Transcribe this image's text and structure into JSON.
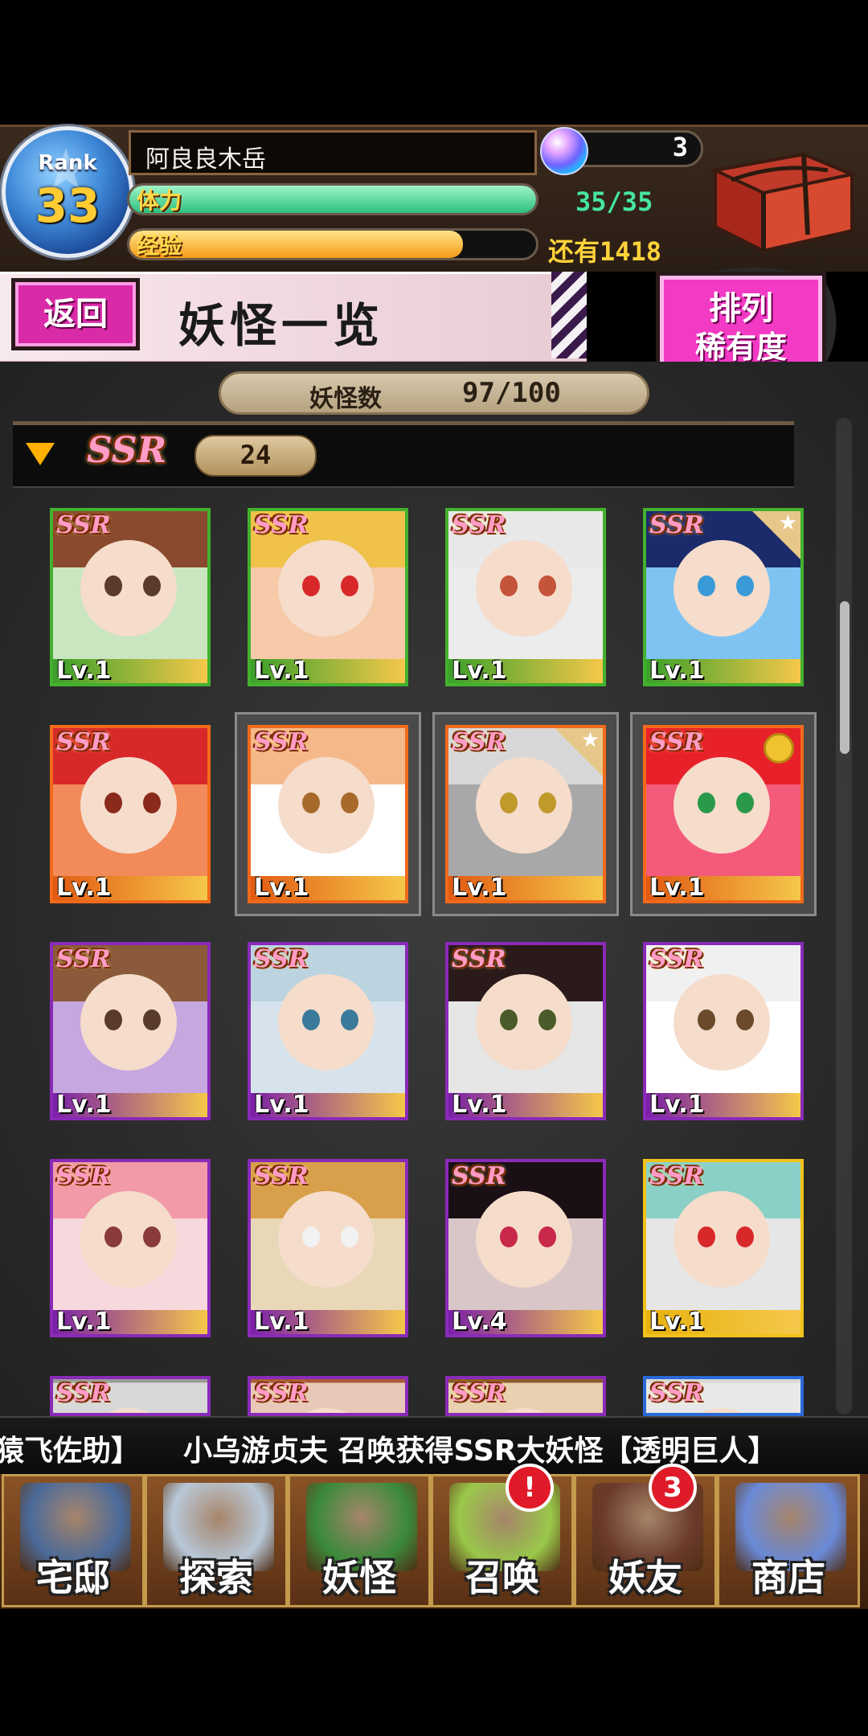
{
  "header": {
    "rank_label": "Rank",
    "rank_value": "33",
    "player_name": "阿良良木岳",
    "gem_count": "3",
    "stamina_label": "体力",
    "stamina_value": "35/35",
    "stamina_fraction": 1.0,
    "exp_label": "经验",
    "exp_remaining": "还有1418",
    "exp_fraction": 0.82
  },
  "titlebar": {
    "back_label": "返回",
    "page_title": "妖怪一览",
    "sort_title": "排列",
    "sort_mode": "稀有度"
  },
  "summary": {
    "count_label": "妖怪数",
    "count_value": "97/100"
  },
  "section": {
    "rarity": "SSR",
    "count": "24"
  },
  "cards": [
    {
      "rarity": "SSR",
      "level": "Lv.1",
      "frame": "#43b12e",
      "level_bar": "#3aa02a",
      "hair": "#8a4a2e",
      "eye": "#5a3a2a",
      "bg": "#c9e6c1"
    },
    {
      "rarity": "SSR",
      "level": "Lv.1",
      "frame": "#43b12e",
      "level_bar": "#3aa02a",
      "hair": "#f0c24a",
      "eye": "#d8282a",
      "bg": "#f6c9a8"
    },
    {
      "rarity": "SSR",
      "level": "Lv.1",
      "frame": "#43b12e",
      "level_bar": "#3aa02a",
      "hair": "#e8e8e8",
      "eye": "#c4543a",
      "bg": "#ececec"
    },
    {
      "rarity": "SSR",
      "level": "Lv.1",
      "frame": "#43b12e",
      "level_bar": "#3aa02a",
      "hair": "#1a2a6a",
      "eye": "#3a9ad8",
      "bg": "#7ec3f2",
      "star": true
    },
    {
      "rarity": "SSR",
      "level": "Lv.1",
      "frame": "#f26a1b",
      "level_bar": "#e25a12",
      "hair": "#d8282a",
      "eye": "#8a2a1a",
      "bg": "#f28a5a"
    },
    {
      "rarity": "SSR",
      "level": "Lv.1",
      "frame": "#f26a1b",
      "level_bar": "#e25a12",
      "hair": "#f5b88a",
      "eye": "#a86a2a",
      "bg": "#ffffff",
      "selected": true
    },
    {
      "rarity": "SSR",
      "level": "Lv.1",
      "frame": "#f26a1b",
      "level_bar": "#e25a12",
      "hair": "#d8d8d8",
      "eye": "#c09a2a",
      "bg": "#a8a8a8",
      "star": true,
      "selected": true
    },
    {
      "rarity": "SSR",
      "level": "Lv.1",
      "frame": "#f26a1b",
      "level_bar": "#e25a12",
      "hair": "#e8202a",
      "eye": "#2a9a4a",
      "bg": "#f45a7a",
      "crown": true,
      "selected": true
    },
    {
      "rarity": "SSR",
      "level": "Lv.1",
      "frame": "#8a2ab8",
      "level_bar": "#7a1fa8",
      "hair": "#8a5a3a",
      "eye": "#5a3a2a",
      "bg": "#c6a7e0"
    },
    {
      "rarity": "SSR",
      "level": "Lv.1",
      "frame": "#8a2ab8",
      "level_bar": "#7a1fa8",
      "hair": "#bcd3e0",
      "eye": "#3a7a9a",
      "bg": "#d6e3ec"
    },
    {
      "rarity": "SSR",
      "level": "Lv.1",
      "frame": "#8a2ab8",
      "level_bar": "#7a1fa8",
      "hair": "#2a1a1a",
      "eye": "#4a5a2a",
      "bg": "#e6e6e6"
    },
    {
      "rarity": "SSR",
      "level": "Lv.1",
      "frame": "#8a2ab8",
      "level_bar": "#7a1fa8",
      "hair": "#f0f0f0",
      "eye": "#6a4a2a",
      "bg": "#ffffff"
    },
    {
      "rarity": "SSR",
      "level": "Lv.1",
      "frame": "#8a2ab8",
      "level_bar": "#7a1fa8",
      "hair": "#f29aa8",
      "eye": "#8a3a3a",
      "bg": "#f7d8dc"
    },
    {
      "rarity": "SSR",
      "level": "Lv.1",
      "frame": "#8a2ab8",
      "level_bar": "#7a1fa8",
      "hair": "#d8a04a",
      "eye": "#f2f2f2",
      "bg": "#e8d8b8"
    },
    {
      "rarity": "SSR",
      "level": "Lv.4",
      "frame": "#8a2ab8",
      "level_bar": "#7a1fa8",
      "hair": "#1a0f14",
      "eye": "#c8284a",
      "bg": "#d8c6c8"
    },
    {
      "rarity": "SSR",
      "level": "Lv.1",
      "frame": "#f2c21a",
      "level_bar": "#e8b210",
      "hair": "#8ad0c6",
      "eye": "#d8282a",
      "bg": "#e6e6e6"
    },
    {
      "rarity": "SSR",
      "level": "",
      "frame": "#8a2ab8",
      "level_bar": "#7a1fa8",
      "hair": "#9a9a9a",
      "eye": "#333333",
      "bg": "#d8d8d8"
    },
    {
      "rarity": "SSR",
      "level": "",
      "frame": "#8a2ab8",
      "level_bar": "#7a1fa8",
      "hair": "#a85a3a",
      "eye": "#333333",
      "bg": "#e8c8b8"
    },
    {
      "rarity": "SSR",
      "level": "",
      "frame": "#8a2ab8",
      "level_bar": "#7a1fa8",
      "hair": "#8a5a2a",
      "eye": "#333333",
      "bg": "#e8d0b0"
    },
    {
      "rarity": "SSR",
      "level": "",
      "frame": "#2a6ad8",
      "level_bar": "#1a5ac8",
      "hair": "#d8d8d8",
      "eye": "#333333",
      "bg": "#e8e8e8"
    }
  ],
  "ticker": {
    "text": "猿飞佐助】　　小乌游贞夫 召唤获得SSR大妖怪【透明巨人】"
  },
  "nav": [
    {
      "label": "宅邸",
      "icon": "mansion-icon",
      "art": "#4a6a9a",
      "badge": ""
    },
    {
      "label": "探索",
      "icon": "magnifier-map-icon",
      "art": "#b8c8d8",
      "badge": ""
    },
    {
      "label": "妖怪",
      "icon": "scroll-icon",
      "art": "#3a8a3a",
      "badge": ""
    },
    {
      "label": "召唤",
      "icon": "summon-star-icon",
      "art": "#9ac84a",
      "badge": "!"
    },
    {
      "label": "妖友",
      "icon": "friend-icon",
      "art": "#6a3a2a",
      "badge": "3"
    },
    {
      "label": "商店",
      "icon": "crystal-orb-icon",
      "art": "#6a8ad8",
      "badge": ""
    }
  ],
  "colors": {
    "stamina": "#46d89a",
    "exp": "#ffae26",
    "accent_pink": "#f23ac4"
  }
}
